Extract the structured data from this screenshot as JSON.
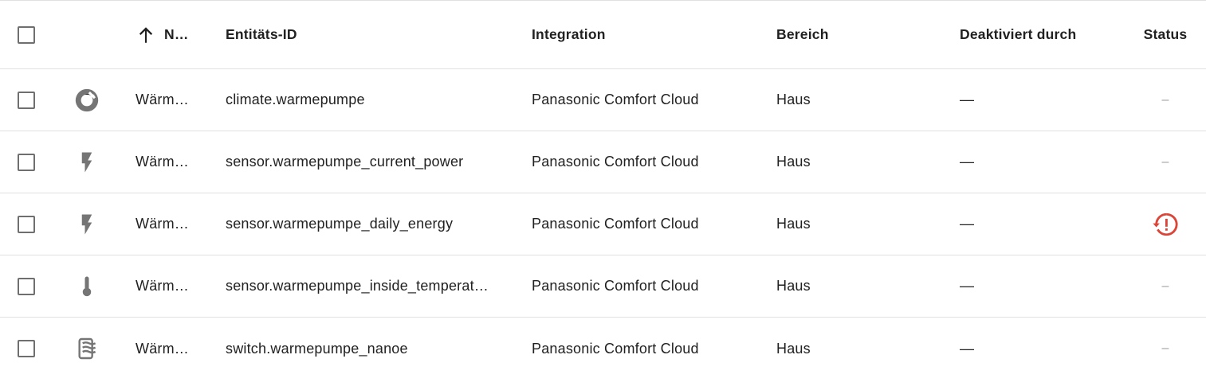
{
  "columns": {
    "name": "N…",
    "entity_id": "Entitäts-ID",
    "integration": "Integration",
    "area": "Bereich",
    "disabled_by": "Deaktiviert durch",
    "status": "Status"
  },
  "rows": [
    {
      "icon": "thermostat-icon",
      "name": "Wärm…",
      "entity_id": "climate.warmepumpe",
      "integration": "Panasonic Comfort Cloud",
      "area": "Haus",
      "disabled_by": "—",
      "status": "–"
    },
    {
      "icon": "flash-icon",
      "name": "Wärm…",
      "entity_id": "sensor.warmepumpe_current_power",
      "integration": "Panasonic Comfort Cloud",
      "area": "Haus",
      "disabled_by": "—",
      "status": "–"
    },
    {
      "icon": "flash-icon",
      "name": "Wärm…",
      "entity_id": "sensor.warmepumpe_daily_energy",
      "integration": "Panasonic Comfort Cloud",
      "area": "Haus",
      "disabled_by": "—",
      "status": "restore-alert-icon"
    },
    {
      "icon": "thermometer-icon",
      "name": "Wärm…",
      "entity_id": "sensor.warmepumpe_inside_temperat…",
      "integration": "Panasonic Comfort Cloud",
      "area": "Haus",
      "disabled_by": "—",
      "status": "–"
    },
    {
      "icon": "air-purifier-icon",
      "name": "Wärm…",
      "entity_id": "switch.warmepumpe_nanoe",
      "integration": "Panasonic Comfort Cloud",
      "area": "Haus",
      "disabled_by": "—",
      "status": "–"
    }
  ],
  "colors": {
    "icon": "#757575",
    "alert": "#db4437",
    "divider": "#e0e0e0"
  }
}
